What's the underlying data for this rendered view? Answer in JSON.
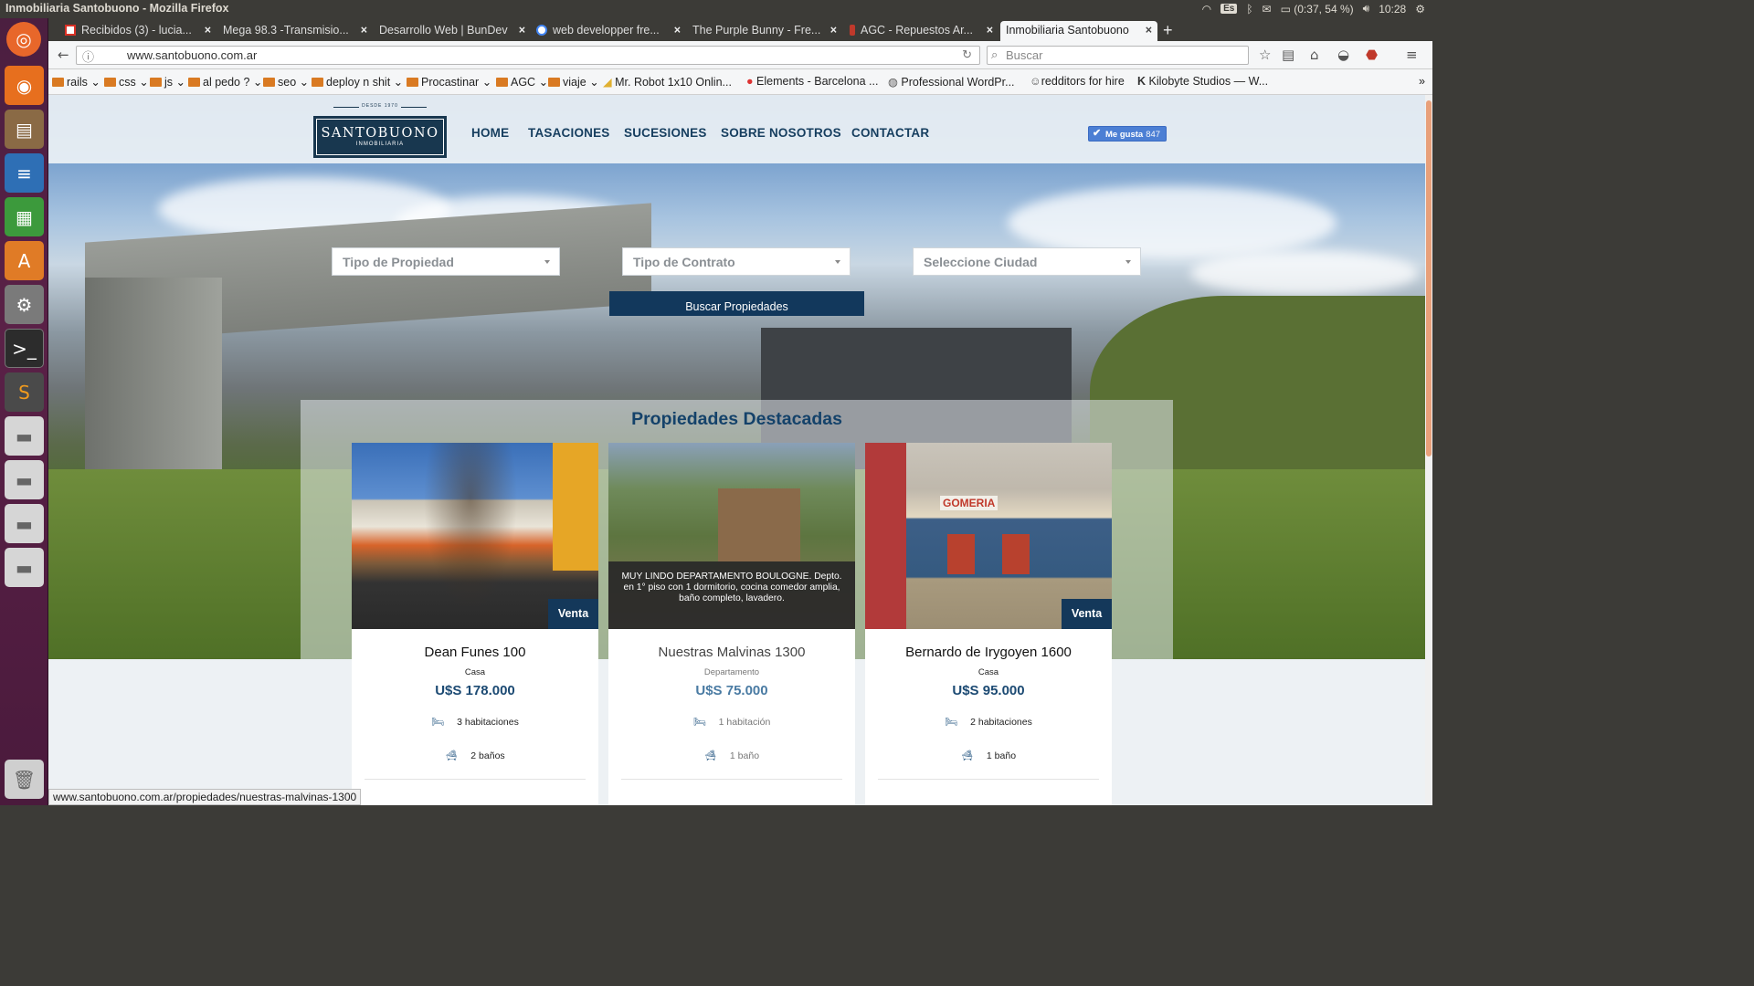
{
  "system": {
    "window_title": "Inmobiliaria Santobuono - Mozilla Firefox",
    "keyboard_layout": "Es",
    "battery": "(0:37, 54 %)",
    "clock": "10:28"
  },
  "launcher": {
    "icons": [
      "ubuntu-dash-icon",
      "firefox-icon",
      "file-manager-icon",
      "writer-icon",
      "calc-icon",
      "software-center-icon",
      "settings-icon",
      "terminal-icon",
      "sublime-text-icon",
      "drive-icon",
      "drive-icon",
      "drive-icon",
      "drive-icon",
      "trash-icon"
    ]
  },
  "browser": {
    "tabs": [
      {
        "label": "Recibidos (3) - lucia...",
        "favicon_color": "#d93025"
      },
      {
        "label": "Mega 98.3 -Transmisio...",
        "favicon_color": ""
      },
      {
        "label": "Desarrollo Web | BunDev",
        "favicon_color": ""
      },
      {
        "label": "web developper fre...",
        "favicon_color": "#4285f4"
      },
      {
        "label": "The Purple Bunny - Fre...",
        "favicon_color": ""
      },
      {
        "label": "AGC - Repuestos Ar...",
        "favicon_color": "#c0392b"
      },
      {
        "label": "Inmobiliaria Santobuono",
        "favicon_color": ""
      }
    ],
    "url": "www.santobuono.com.ar",
    "search_placeholder": "Buscar",
    "bookmarks": [
      {
        "label": "rails",
        "folder": true
      },
      {
        "label": "css",
        "folder": true
      },
      {
        "label": "js",
        "folder": true
      },
      {
        "label": "al pedo ?",
        "folder": true
      },
      {
        "label": "seo",
        "folder": true
      },
      {
        "label": "deploy n shit",
        "folder": true
      },
      {
        "label": "Procastinar",
        "folder": true
      },
      {
        "label": "AGC",
        "folder": true
      },
      {
        "label": "viaje",
        "folder": true
      },
      {
        "label": "Mr. Robot 1x10 Onlin...",
        "folder": false
      },
      {
        "label": "Elements - Barcelona ...",
        "folder": false
      },
      {
        "label": "Professional WordPr...",
        "folder": false
      },
      {
        "label": "redditors for hire",
        "folder": false
      },
      {
        "label": "Kilobyte Studios — W...",
        "folder": false
      }
    ],
    "status_url": "www.santobuono.com.ar/propiedades/nuestras-malvinas-1300"
  },
  "site": {
    "logo_since": "DESDE 1970",
    "logo_name": "SANTOBUONO",
    "logo_sub": "INMOBILIARIA",
    "nav": [
      "HOME",
      "TASACIONES",
      "SUCESIONES",
      "SOBRE NOSOTROS",
      "CONTACTAR"
    ],
    "like_label": "Me gusta",
    "like_count": "847",
    "search": {
      "tipo_propiedad": "Tipo de Propiedad",
      "tipo_contrato": "Tipo de Contrato",
      "ciudad": "Seleccione Ciudad",
      "button": "Buscar Propiedades"
    },
    "featured_title": "Propiedades Destacadas",
    "properties": [
      {
        "name": "Dean Funes 100",
        "type": "Casa",
        "price": "U$S 178.000",
        "rooms": "3 habitaciones",
        "baths": "2 baños",
        "badge": "Venta"
      },
      {
        "name": "Nuestras Malvinas 1300",
        "type": "Departamento",
        "price": "U$S 75.000",
        "rooms": "1 habitación",
        "baths": "1 baño",
        "description": "MUY LINDO DEPARTAMENTO BOULOGNE. Depto. en 1° piso con 1 dormitorio, cocina comedor amplia, baño completo, lavadero."
      },
      {
        "name": "Bernardo de Irygoyen 1600",
        "type": "Casa",
        "price": "U$S 95.000",
        "rooms": "2 habitaciones",
        "baths": "1 baño",
        "badge": "Venta",
        "shop_sign": "GOMERIA"
      }
    ]
  },
  "colors": {
    "brand": "#18374f",
    "accent": "#14426a",
    "like": "#4c7fd4"
  }
}
